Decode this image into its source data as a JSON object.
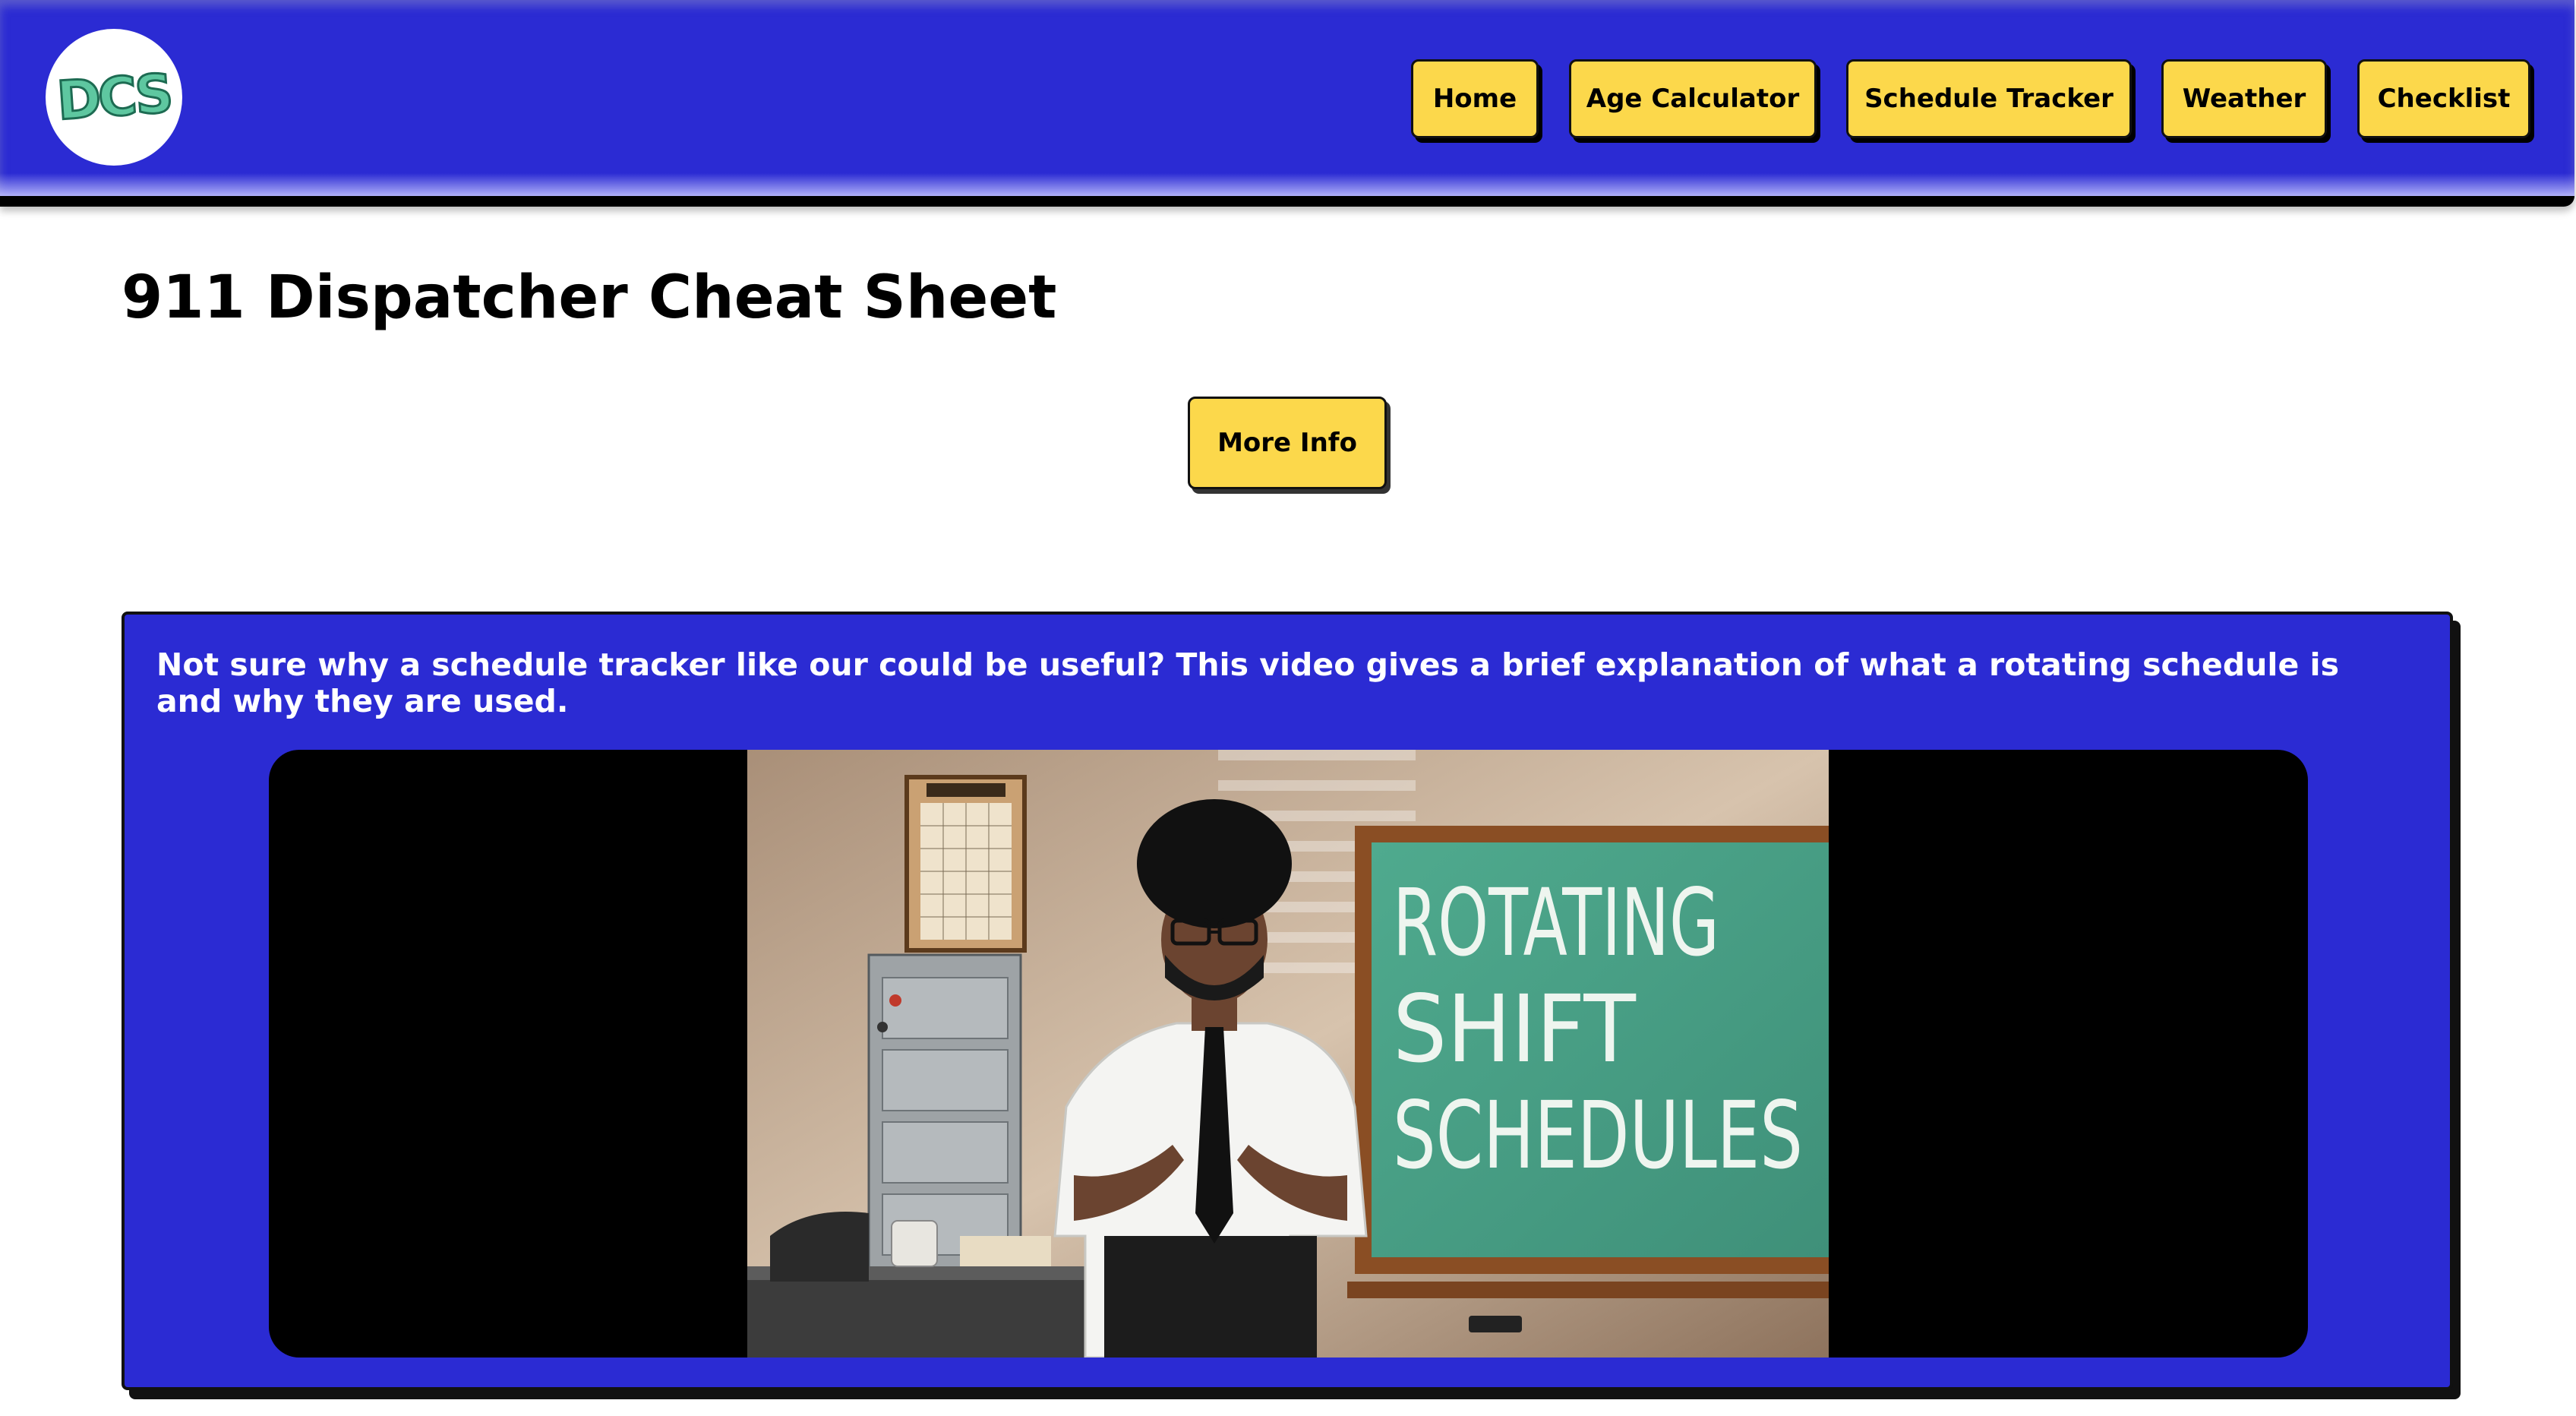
{
  "header": {
    "logo_text": "DCS",
    "nav": [
      {
        "label": "Home"
      },
      {
        "label": "Age Calculator"
      },
      {
        "label": "Schedule Tracker"
      },
      {
        "label": "Weather"
      },
      {
        "label": "Checklist"
      }
    ]
  },
  "main": {
    "title": "911 Dispatcher Cheat Sheet",
    "more_info_label": "More Info"
  },
  "video_section": {
    "description": "Not sure why a schedule tracker like our could be useful? This video gives a brief explanation of what a rotating schedule is and why they are used.",
    "chalkboard_lines": [
      "ROTATING",
      "SHIFT",
      "SCHEDULES"
    ]
  },
  "colors": {
    "header_bg": "#2b2bd3",
    "button_bg": "#fcd84b",
    "logo_fill": "#5ec7a0",
    "chalkboard": "#3f9e84"
  }
}
